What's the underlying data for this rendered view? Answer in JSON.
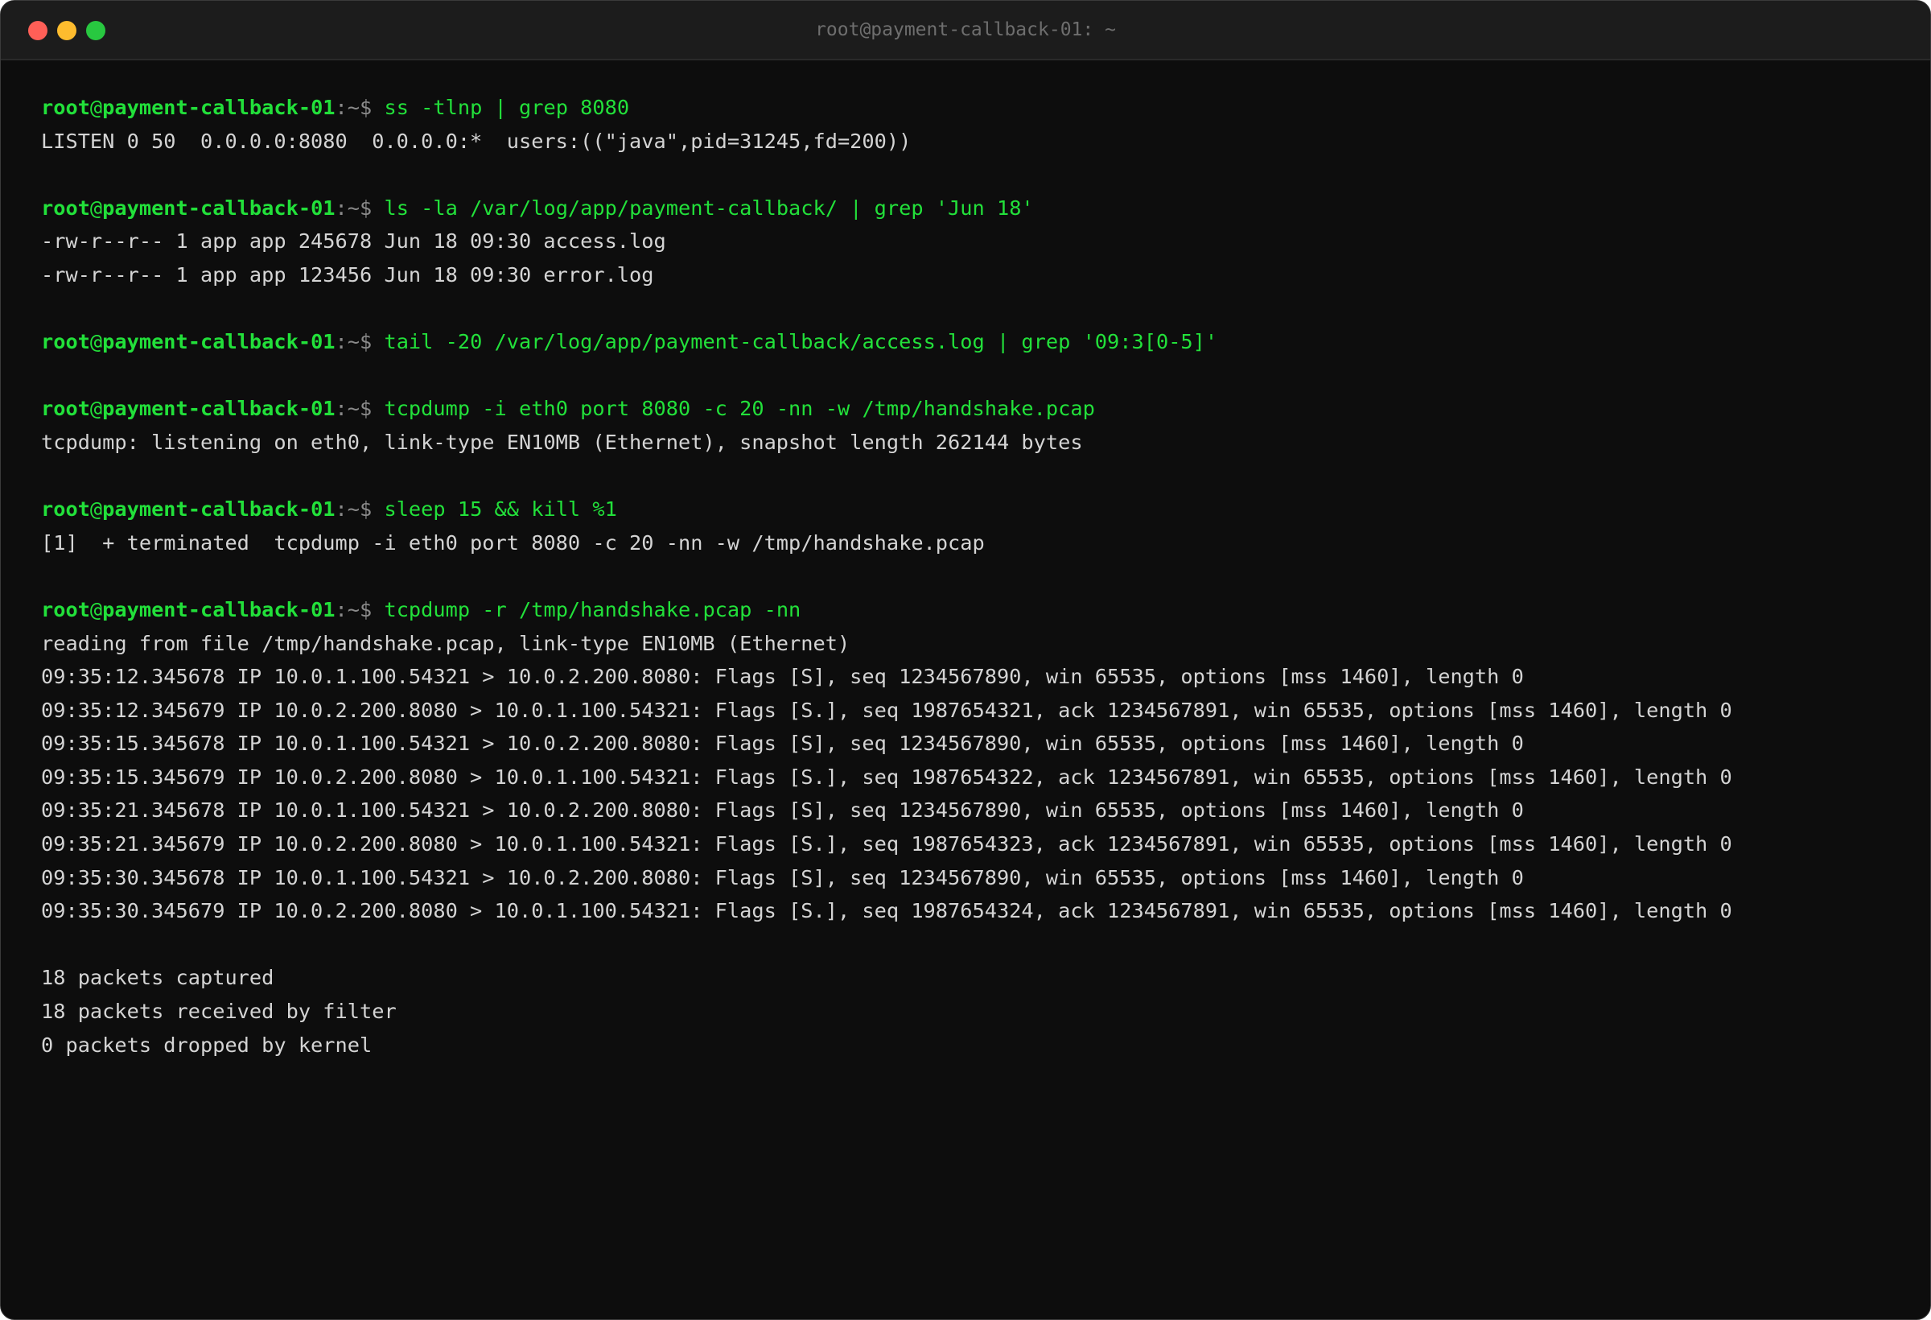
{
  "window": {
    "title": "root@payment-callback-01: ~"
  },
  "prompt": {
    "user": "root",
    "at": "@",
    "host": "payment-callback-01",
    "colon": ":",
    "path": "~",
    "symbol": "$ "
  },
  "blocks": [
    {
      "command": "ss -tlnp | grep 8080",
      "output": [
        "LISTEN 0 50  0.0.0.0:8080  0.0.0.0:*  users:((\"java\",pid=31245,fd=200))"
      ]
    },
    {
      "command": "ls -la /var/log/app/payment-callback/ | grep 'Jun 18'",
      "output": [
        "-rw-r--r-- 1 app app 245678 Jun 18 09:30 access.log",
        "-rw-r--r-- 1 app app 123456 Jun 18 09:30 error.log"
      ]
    },
    {
      "command": "tail -20 /var/log/app/payment-callback/access.log | grep '09:3[0-5]'",
      "output": []
    },
    {
      "command": "tcpdump -i eth0 port 8080 -c 20 -nn -w /tmp/handshake.pcap",
      "output": [
        "tcpdump: listening on eth0, link-type EN10MB (Ethernet), snapshot length 262144 bytes"
      ]
    },
    {
      "command": "sleep 15 && kill %1",
      "output": [
        "[1]  + terminated  tcpdump -i eth0 port 8080 -c 20 -nn -w /tmp/handshake.pcap"
      ]
    },
    {
      "command": "tcpdump -r /tmp/handshake.pcap -nn",
      "output": [
        "reading from file /tmp/handshake.pcap, link-type EN10MB (Ethernet)",
        "09:35:12.345678 IP 10.0.1.100.54321 > 10.0.2.200.8080: Flags [S], seq 1234567890, win 65535, options [mss 1460], length 0",
        "09:35:12.345679 IP 10.0.2.200.8080 > 10.0.1.100.54321: Flags [S.], seq 1987654321, ack 1234567891, win 65535, options [mss 1460], length 0",
        "09:35:15.345678 IP 10.0.1.100.54321 > 10.0.2.200.8080: Flags [S], seq 1234567890, win 65535, options [mss 1460], length 0",
        "09:35:15.345679 IP 10.0.2.200.8080 > 10.0.1.100.54321: Flags [S.], seq 1987654322, ack 1234567891, win 65535, options [mss 1460], length 0",
        "09:35:21.345678 IP 10.0.1.100.54321 > 10.0.2.200.8080: Flags [S], seq 1234567890, win 65535, options [mss 1460], length 0",
        "09:35:21.345679 IP 10.0.2.200.8080 > 10.0.1.100.54321: Flags [S.], seq 1987654323, ack 1234567891, win 65535, options [mss 1460], length 0",
        "09:35:30.345678 IP 10.0.1.100.54321 > 10.0.2.200.8080: Flags [S], seq 1234567890, win 65535, options [mss 1460], length 0",
        "09:35:30.345679 IP 10.0.2.200.8080 > 10.0.1.100.54321: Flags [S.], seq 1987654324, ack 1234567891, win 65535, options [mss 1460], length 0",
        "",
        "18 packets captured",
        "18 packets received by filter",
        "0 packets dropped by kernel"
      ]
    }
  ],
  "colors": {
    "prompt_green": "#22e03a",
    "background": "#0d0d0d",
    "text": "#d4d4d4",
    "close": "#ff5f57",
    "minimize": "#febc2e",
    "zoom": "#28c840"
  }
}
